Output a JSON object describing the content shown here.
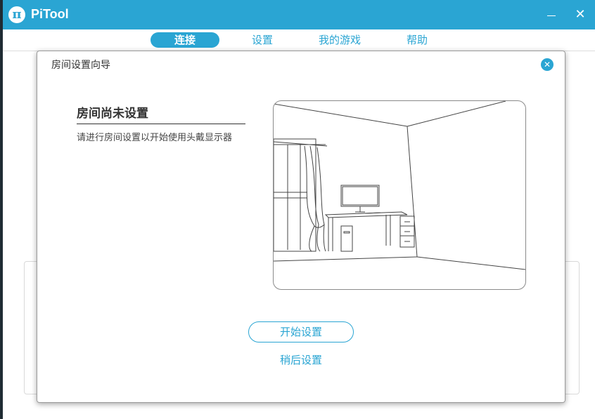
{
  "app": {
    "title": "PiTool",
    "logo_glyph": "π"
  },
  "window_controls": {
    "minimize_icon": "minimize-icon",
    "close_glyph": "✕"
  },
  "nav": {
    "tabs": [
      {
        "label": "连接",
        "active": true
      },
      {
        "label": "设置",
        "active": false
      },
      {
        "label": "我的游戏",
        "active": false
      },
      {
        "label": "帮助",
        "active": false
      }
    ]
  },
  "dialog": {
    "title": "房间设置向导",
    "close_glyph": "✕",
    "heading": "房间尚未设置",
    "description": "请进行房间设置以开始使用头戴显示器",
    "illustration_icon": "room-illustration",
    "primary_button": "开始设置",
    "secondary_link": "稍后设置"
  },
  "colors": {
    "accent": "#2aa5d3",
    "text": "#333333"
  }
}
